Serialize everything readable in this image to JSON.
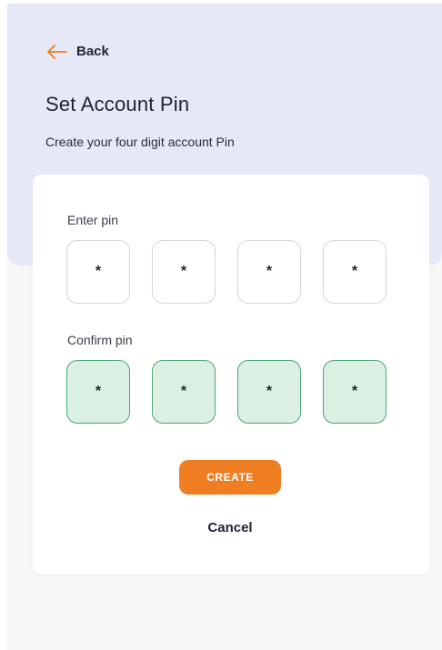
{
  "header": {
    "back_label": "Back",
    "title": "Set Account Pin",
    "subtitle": "Create your four digit account Pin"
  },
  "enter_pin": {
    "label": "Enter pin",
    "digits": [
      "*",
      "*",
      "*",
      "*"
    ]
  },
  "confirm_pin": {
    "label": "Confirm pin",
    "digits": [
      "*",
      "*",
      "*",
      "*"
    ]
  },
  "actions": {
    "create_label": "CREATE",
    "cancel_label": "Cancel"
  },
  "colors": {
    "accent": "#ef7d22",
    "header_bg": "#e6e8f6",
    "confirm_fill": "#dcefe3",
    "confirm_border": "#4aa872"
  }
}
